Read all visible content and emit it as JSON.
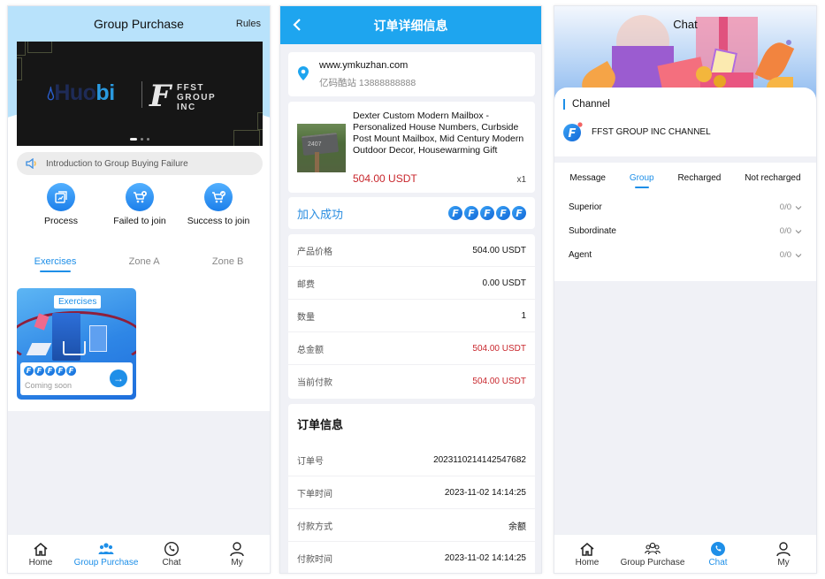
{
  "screen1": {
    "header": {
      "title": "Group Purchase",
      "rules_label": "Rules"
    },
    "banner": {
      "brand_left": "Huo",
      "brand_left_accent": "bi",
      "brand_right_letter": "F",
      "brand_right_lines": [
        "FFST",
        "GROUP",
        "INC"
      ],
      "slides": 3,
      "active_slide": 1
    },
    "notice": {
      "icon": "speaker-icon",
      "text": "Introduction to Group Buying Failure"
    },
    "quick_actions": [
      {
        "label": "Process",
        "icon": "process-icon"
      },
      {
        "label": "Failed to join",
        "icon": "cart-failed-icon"
      },
      {
        "label": "Success to join",
        "icon": "cart-success-icon"
      }
    ],
    "zone_tabs": [
      {
        "label": "Exercises",
        "active": true
      },
      {
        "label": "Zone A",
        "active": false
      },
      {
        "label": "Zone B",
        "active": false
      }
    ],
    "exercise_card": {
      "tag": "Exercises",
      "coin_letter": "F",
      "coin_count": 5,
      "status": "Coming soon",
      "action_icon": "arrow-right-icon"
    }
  },
  "screen2": {
    "header": {
      "title": "订单详细信息",
      "back_icon": "chevron-left-icon"
    },
    "address": {
      "site": "www.ymkuzhan.com",
      "contact": "亿码酷站 13888888888"
    },
    "product": {
      "name": "Dexter Custom Modern Mailbox - Personalized House Numbers, Curbside Post Mount Mailbox, Mid Century Modern Outdoor Decor, Housewarming Gift",
      "price": "504.00 USDT",
      "quantity": "x1",
      "image_label": "2407"
    },
    "join_status": {
      "label": "加入成功",
      "coin_letter": "F",
      "coin_count": 5
    },
    "summary": [
      {
        "key": "产品价格",
        "value": "504.00 USDT",
        "highlight": false
      },
      {
        "key": "邮费",
        "value": "0.00 USDT",
        "highlight": false
      },
      {
        "key": "数量",
        "value": "1",
        "highlight": false
      },
      {
        "key": "总金额",
        "value": "504.00 USDT",
        "highlight": true
      },
      {
        "key": "当前付款",
        "value": "504.00 USDT",
        "highlight": true
      }
    ],
    "order_info": {
      "title": "订单信息",
      "rows": [
        {
          "key": "订单号",
          "value": "2023110214142547682"
        },
        {
          "key": "下单时间",
          "value": "2023-11-02 14:14:25"
        },
        {
          "key": "付款方式",
          "value": "余额"
        },
        {
          "key": "付款时间",
          "value": "2023-11-02 14:14:25"
        }
      ]
    }
  },
  "screen3": {
    "header": {
      "title": "Chat"
    },
    "channel": {
      "title": "Channel",
      "name": "FFST GROUP INC CHANNEL",
      "unread_dot": true
    },
    "group_tabs": [
      {
        "label": "Message",
        "active": false
      },
      {
        "label": "Group",
        "active": true
      },
      {
        "label": "Recharged",
        "active": false
      },
      {
        "label": "Not recharged",
        "active": false
      }
    ],
    "group_rows": [
      {
        "label": "Superior",
        "count": "0/0"
      },
      {
        "label": "Subordinate",
        "count": "0/0"
      },
      {
        "label": "Agent",
        "count": "0/0"
      }
    ]
  },
  "tabbar": {
    "items": [
      {
        "label": "Home",
        "icon": "home-icon"
      },
      {
        "label": "Group Purchase",
        "icon": "group-icon"
      },
      {
        "label": "Chat",
        "icon": "chat-icon"
      },
      {
        "label": "My",
        "icon": "user-icon"
      }
    ],
    "screen1_active": 1,
    "screen3_active": 2
  },
  "colors": {
    "accent": "#1e8fe8",
    "header_blue": "#1ea5ef",
    "price_red": "#c8262c",
    "sky": "#b8e2fb"
  }
}
